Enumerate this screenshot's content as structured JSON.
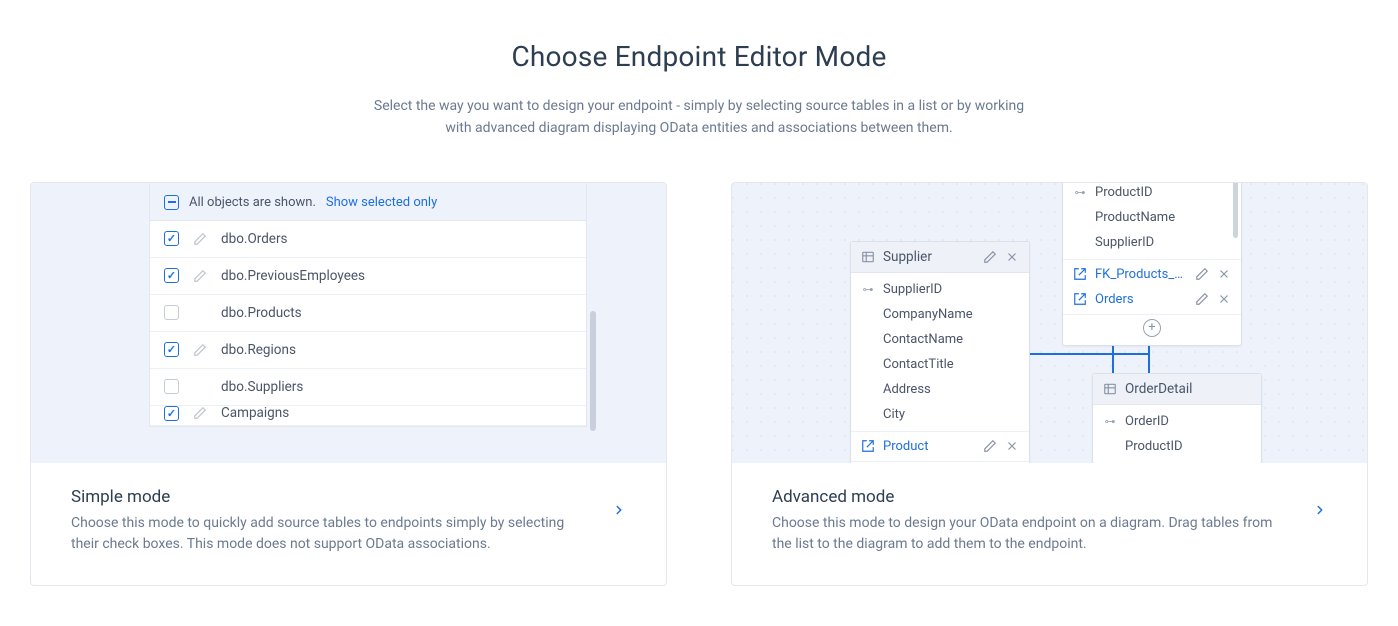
{
  "header": {
    "title": "Choose Endpoint Editor Mode",
    "subtitle": "Select the way you want to design your endpoint - simply by selecting source tables in a list or by working with advanced diagram displaying OData entities and associations between them."
  },
  "simple": {
    "filter": {
      "text": "All objects are shown.",
      "link": "Show selected only"
    },
    "rows": [
      {
        "checked": true,
        "editable": true,
        "label": "dbo.Orders"
      },
      {
        "checked": true,
        "editable": true,
        "label": "dbo.PreviousEmployees"
      },
      {
        "checked": false,
        "editable": false,
        "label": "dbo.Products"
      },
      {
        "checked": true,
        "editable": true,
        "label": "dbo.Regions"
      },
      {
        "checked": false,
        "editable": false,
        "label": "dbo.Suppliers"
      },
      {
        "checked": true,
        "editable": true,
        "label": "Campaigns"
      }
    ],
    "title": "Simple mode",
    "desc": "Choose this mode to quickly add source tables to endpoints simply by selecting their check boxes. This mode does not support OData associations."
  },
  "advanced": {
    "supplier": {
      "title": "Supplier",
      "fields": [
        {
          "key": true,
          "label": "SupplierID"
        },
        {
          "key": false,
          "label": "CompanyName"
        },
        {
          "key": false,
          "label": "ContactName"
        },
        {
          "key": false,
          "label": "ContactTitle"
        },
        {
          "key": false,
          "label": "Address"
        },
        {
          "key": false,
          "label": "City"
        }
      ],
      "assoc": [
        {
          "label": "Product"
        }
      ]
    },
    "product": {
      "fields": [
        {
          "key": true,
          "label": "ProductID"
        },
        {
          "key": false,
          "label": "ProductName"
        },
        {
          "key": false,
          "label": "SupplierID"
        }
      ],
      "assoc": [
        {
          "label": "FK_Products_Sup..."
        },
        {
          "label": "Orders"
        }
      ]
    },
    "orderdetail": {
      "title": "OrderDetail",
      "fields": [
        {
          "key": true,
          "label": "OrderID"
        },
        {
          "key": false,
          "label": "ProductID"
        }
      ]
    },
    "title": "Advanced mode",
    "desc": "Choose this mode to design your OData endpoint on a diagram. Drag tables from the list to the diagram to add them to the endpoint."
  }
}
